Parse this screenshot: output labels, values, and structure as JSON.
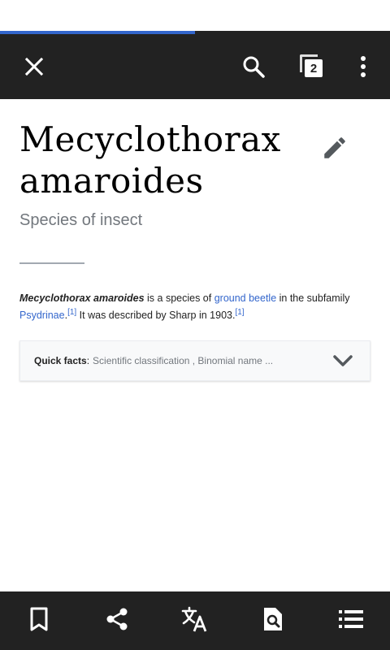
{
  "page_load_progress": 0.5,
  "toolbar": {
    "close_icon": "close-icon",
    "search_icon": "search-icon",
    "tabs_count": "2",
    "overflow_icon": "more-vert-icon"
  },
  "article": {
    "title": "Mecyclothorax amaroides",
    "description": "Species of insect",
    "intro": {
      "bold_name": "Mecyclothorax amaroides",
      "text_1": " is a species of ",
      "link_1": "ground beetle",
      "text_2": " in the subfamily ",
      "link_2": "Psydrinae",
      "text_3": ".",
      "ref_1": "[1]",
      "text_4": " It was described by Sharp in 1903.",
      "ref_2": "[1]"
    }
  },
  "quick_facts": {
    "label": "Quick facts",
    "separator": ":",
    "summary": "Scientific classification , Binomial name ..."
  },
  "bottom_bar": {
    "icons": [
      "bookmark-icon",
      "share-icon",
      "translate-icon",
      "find-in-page-icon",
      "contents-icon"
    ]
  },
  "colors": {
    "toolbar": "#222222",
    "link": "#3366cc",
    "progress": "#3366cc"
  }
}
